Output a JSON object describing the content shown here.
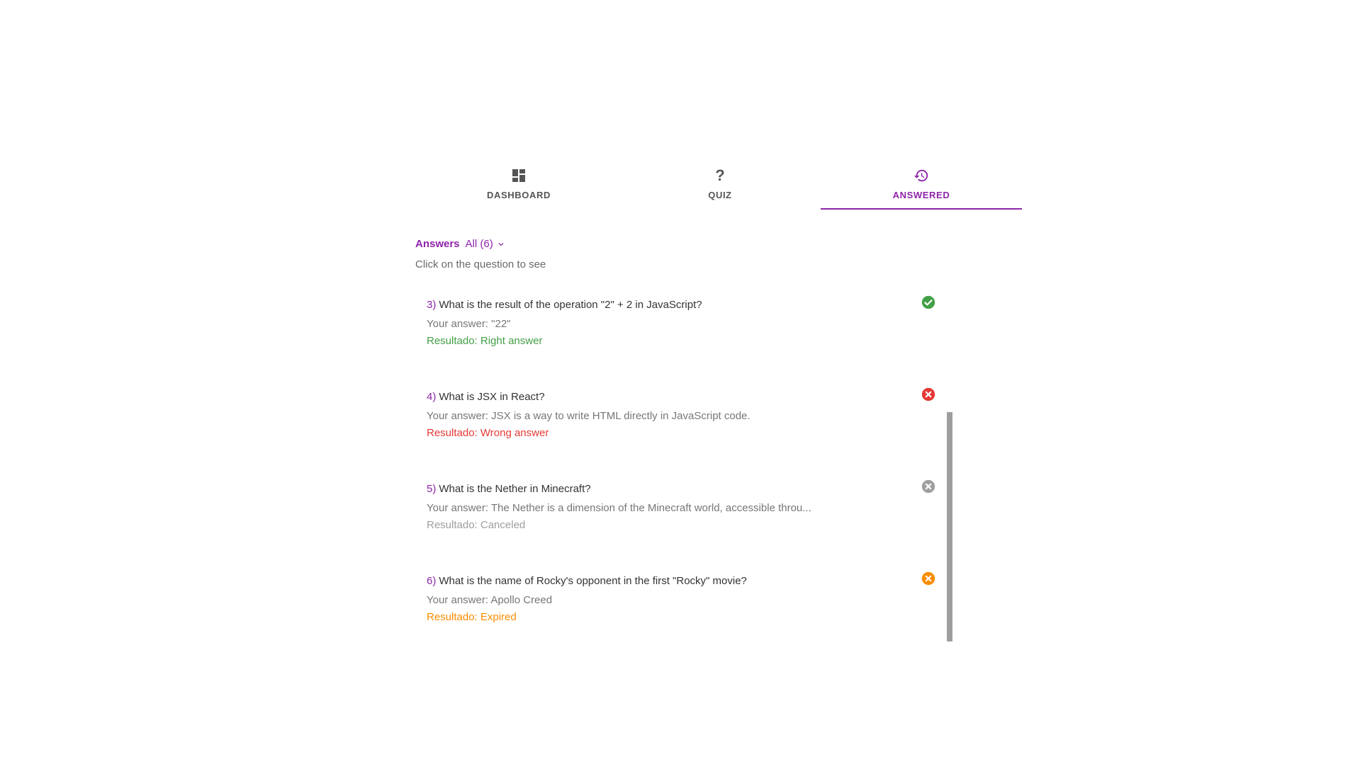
{
  "tabs": [
    {
      "label": "DASHBOARD",
      "icon": "dashboard-icon",
      "active": false
    },
    {
      "label": "QUIZ",
      "icon": "question-mark-icon",
      "active": false
    },
    {
      "label": "ANSWERED",
      "icon": "history-icon",
      "active": true
    }
  ],
  "filter": {
    "label": "Answers",
    "selected": "All (6)"
  },
  "hint": "Click on the question to see",
  "colors": {
    "accent": "#8e24aa",
    "right": "#43a047",
    "wrong": "#e53935",
    "canceled": "#9e9e9e",
    "expired": "#fb8c00"
  },
  "answers": [
    {
      "number": "3)",
      "question": "What is the result of the operation \"2\" + 2 in JavaScript?",
      "your_answer": "Your answer: \"22\"",
      "result": "Resultado: Right answer",
      "status": "right",
      "icon": "check-circle-icon"
    },
    {
      "number": "4)",
      "question": "What is JSX in React?",
      "your_answer": "Your answer: JSX is a way to write HTML directly in JavaScript code.",
      "result": "Resultado: Wrong answer",
      "status": "wrong",
      "icon": "cancel-circle-icon"
    },
    {
      "number": "5)",
      "question": "What is the Nether in Minecraft?",
      "your_answer": "Your answer: The Nether is a dimension of the Minecraft world, accessible throu...",
      "result": "Resultado: Canceled",
      "status": "canceled",
      "icon": "cancel-circle-icon"
    },
    {
      "number": "6)",
      "question": "What is the name of Rocky's opponent in the first \"Rocky\" movie?",
      "your_answer": "Your answer: Apollo Creed",
      "result": "Resultado: Expired",
      "status": "expired",
      "icon": "cancel-circle-icon"
    }
  ]
}
